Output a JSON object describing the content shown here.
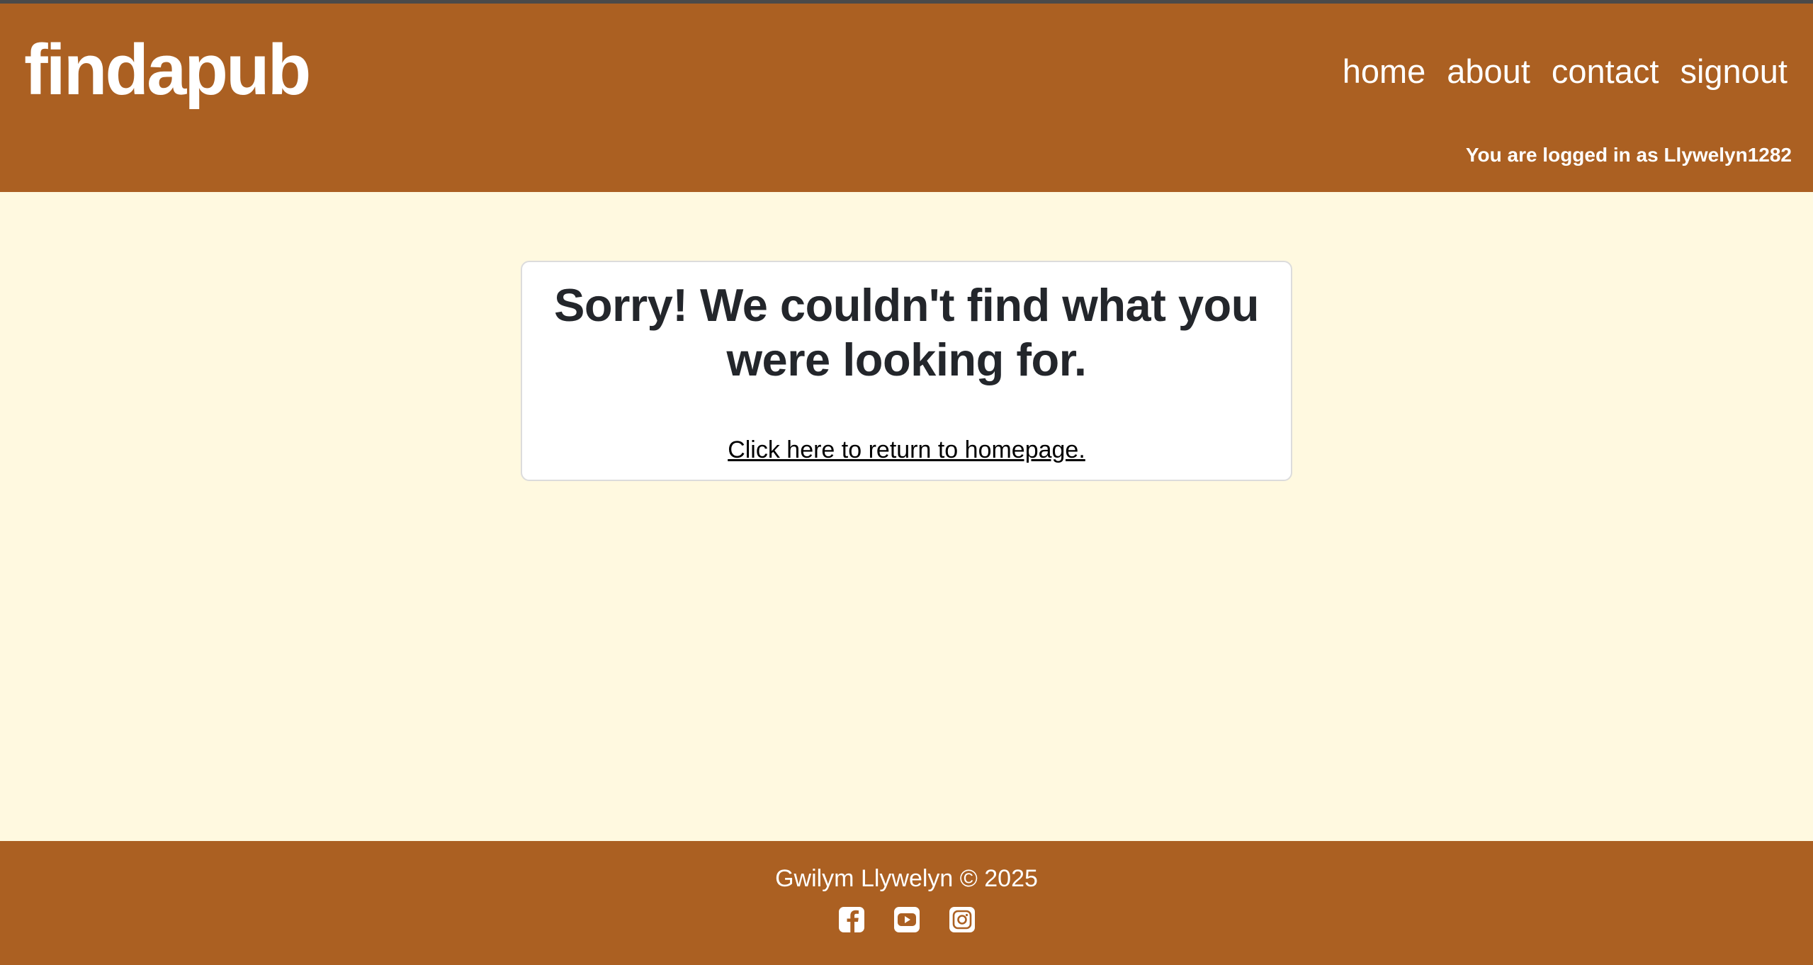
{
  "header": {
    "brand": "findapub",
    "nav": [
      {
        "label": "home"
      },
      {
        "label": "about"
      },
      {
        "label": "contact"
      },
      {
        "label": "signout"
      }
    ],
    "login_status": "You are logged in as Llywelyn1282"
  },
  "main": {
    "heading": "Sorry! We couldn't find what you were looking for.",
    "return_link": "Click here to return to homepage."
  },
  "footer": {
    "credit": "Gwilym Llywelyn © 2025",
    "socials": [
      {
        "icon": "facebook-icon"
      },
      {
        "icon": "youtube-icon"
      },
      {
        "icon": "instagram-icon"
      }
    ]
  },
  "colors": {
    "brand": "#ab6022",
    "background": "#fff9e0",
    "text": "#23262b"
  }
}
